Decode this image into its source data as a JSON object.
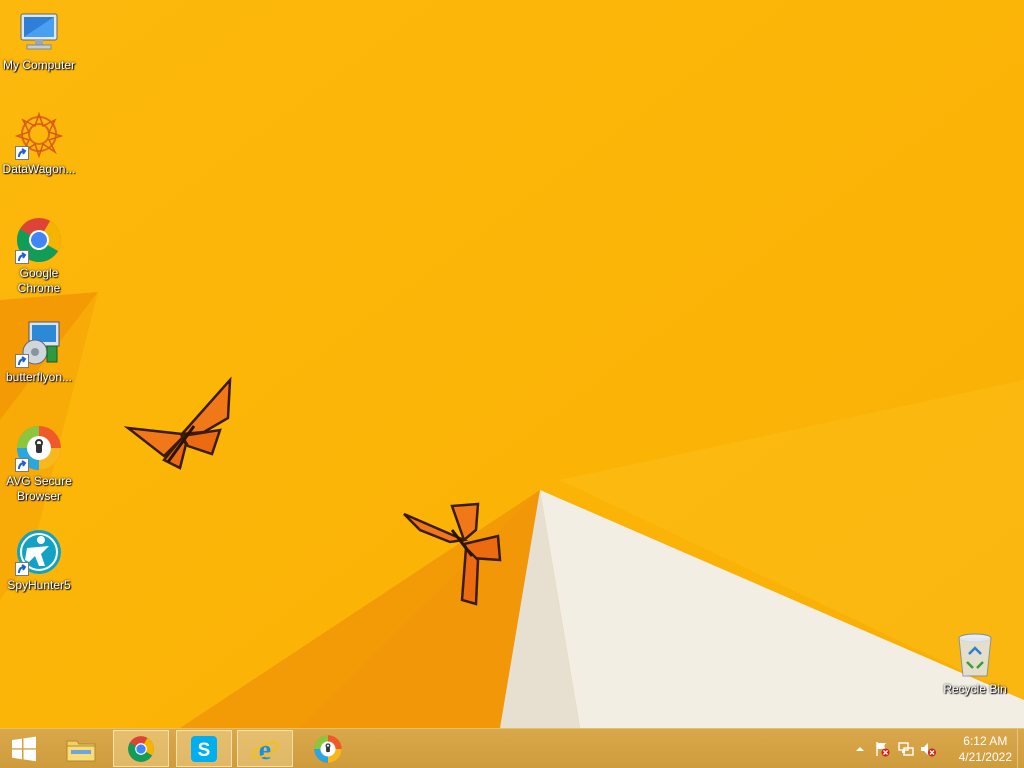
{
  "desktop": {
    "icons": [
      {
        "label": "My Computer",
        "icon": "computer-icon"
      },
      {
        "label": "DataWagon...",
        "icon": "datawagon-icon"
      },
      {
        "label": "Google Chrome",
        "icon": "chrome-icon"
      },
      {
        "label": "butterflyon...",
        "icon": "installer-icon"
      },
      {
        "label": "AVG Secure Browser",
        "icon": "avg-browser-icon"
      },
      {
        "label": "SpyHunter5",
        "icon": "spyhunter-icon"
      },
      {
        "label": "Recycle Bin",
        "icon": "recycle-bin-icon"
      }
    ],
    "wallpaper_colors": {
      "base": "#fbb406",
      "light": "#fcc21c",
      "dark": "#f29a05",
      "white": "#f4efe4"
    }
  },
  "taskbar": {
    "buttons": [
      {
        "icon": "windows-start-icon"
      },
      {
        "icon": "file-explorer-icon"
      },
      {
        "icon": "chrome-icon"
      },
      {
        "icon": "skype-icon"
      },
      {
        "icon": "internet-explorer-icon"
      },
      {
        "icon": "avg-browser-icon"
      }
    ],
    "tray": {
      "icons": [
        "show-hidden-icons-arrow-icon",
        "action-center-flag-icon",
        "network-icon",
        "volume-muted-icon"
      ],
      "time": "6:12 AM",
      "date": "4/21/2022"
    }
  }
}
